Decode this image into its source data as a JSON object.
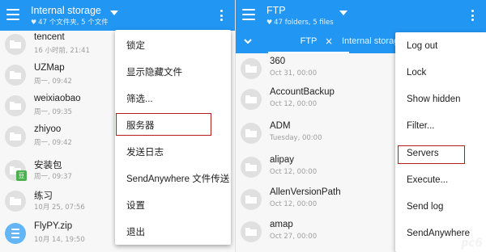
{
  "left": {
    "title": "Internal storage",
    "subtitle": "47 个文件夹, 5 个文件",
    "files": [
      {
        "name": "tencent",
        "date": "16 小时前, 21:41"
      },
      {
        "name": "UZMap",
        "date": "周一, 09:42"
      },
      {
        "name": "weixiaobao",
        "date": "周一, 09:35"
      },
      {
        "name": "zhiyoo",
        "date": "周一, 09:42"
      },
      {
        "name": "安装包",
        "date": "周一, 09:37",
        "badge": "豆"
      },
      {
        "name": "练习",
        "date": "10月 25, 07:56"
      },
      {
        "name": "FlyPY.zip",
        "date": "10月 14, 19:50"
      }
    ],
    "menu": [
      "锁定",
      "显示隐藏文件",
      "筛选...",
      "服务器",
      "发送日志",
      "SendAnywhere 文件传送",
      "设置",
      "退出"
    ]
  },
  "right": {
    "title": "FTP",
    "subtitle": "47 folders, 5 files",
    "tabs": {
      "active": "FTP",
      "close": "×",
      "other": "Internal storage"
    },
    "files": [
      {
        "name": "360",
        "date": "Oct 31, 00:00"
      },
      {
        "name": "AccountBackup",
        "date": "Oct 12, 00:00"
      },
      {
        "name": "ADM",
        "date": "Tuesday, 00:00"
      },
      {
        "name": "alipay",
        "date": "Oct 12, 00:00"
      },
      {
        "name": "AllenVersionPath",
        "date": "Oct 12, 00:00"
      },
      {
        "name": "amap",
        "date": "Oct 27, 00:00"
      }
    ],
    "menu": [
      "Log out",
      "Lock",
      "Show hidden",
      "Filter...",
      "Servers",
      "Execute...",
      "Send log",
      "SendAnywhere"
    ]
  },
  "colors": {
    "accent": "#2196f3",
    "highlight_box": "#b71c1c",
    "apk_badge": "#4caf50"
  },
  "watermark": "pc6"
}
